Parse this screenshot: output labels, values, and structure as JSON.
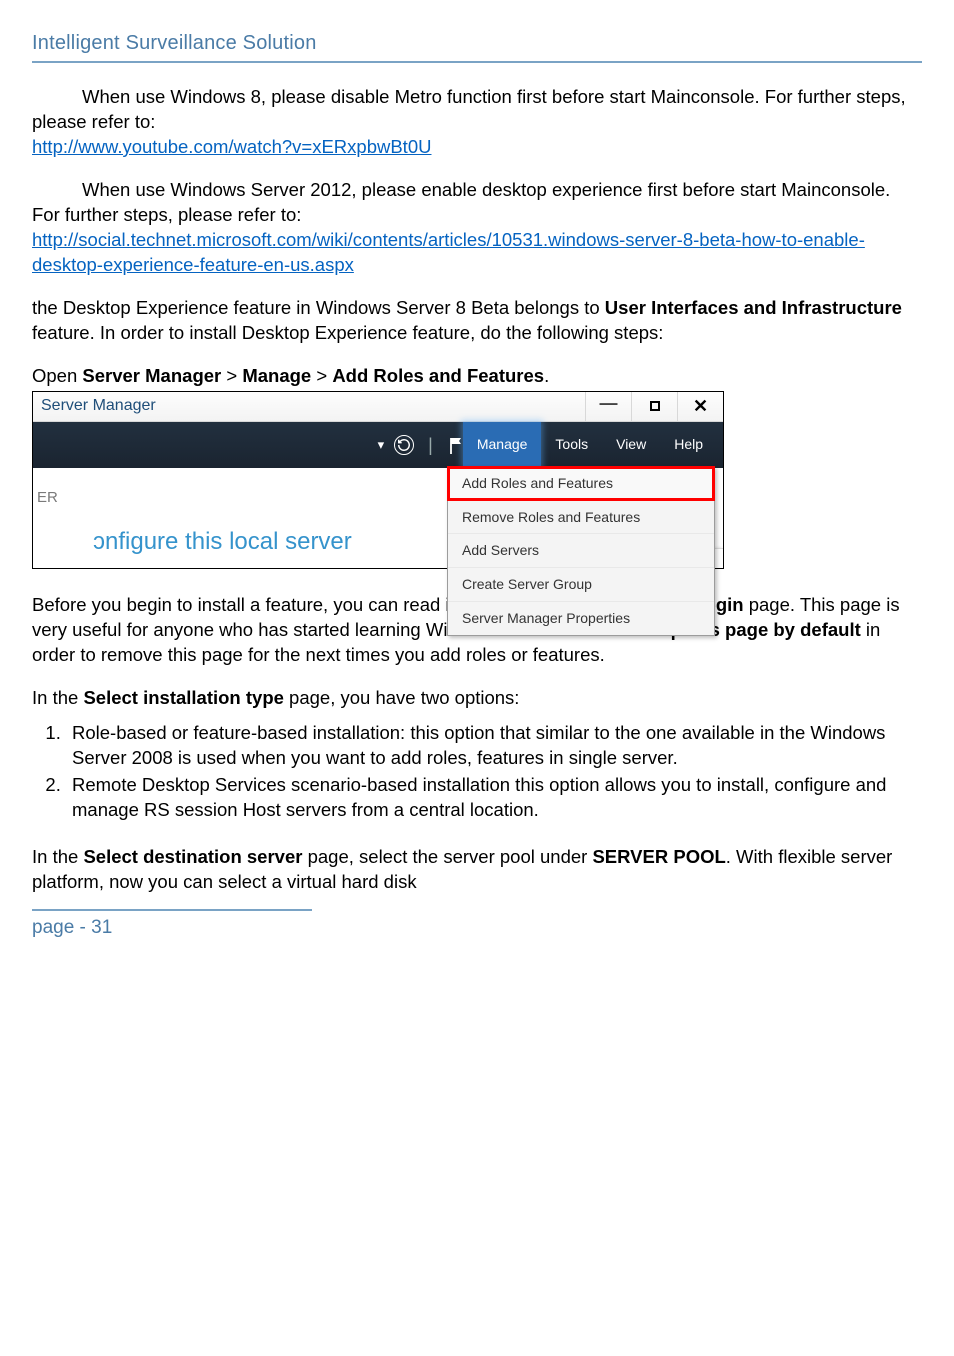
{
  "header": {
    "title": "Intelligent Surveillance Solution"
  },
  "p1": {
    "text1": "When use Windows 8, please disable Metro function first before start Mainconsole. For further steps, please refer to:",
    "link": "http://www.youtube.com/watch?v=xERxpbwBt0U"
  },
  "p2": {
    "text1": "When use Windows Server 2012, please enable desktop experience first before start Mainconsole. For further steps, please refer to:",
    "link": "http://social.technet.microsoft.com/wiki/contents/articles/10531.windows-server-8-beta-how-to-enable-desktop-experience-feature-en-us.aspx"
  },
  "p3": {
    "a": "the Desktop Experience feature in Windows Server 8 Beta belongs to ",
    "b": "User Interfaces and Infrastructure",
    "c": " feature. In order to install Desktop Experience feature, do the following steps:"
  },
  "breadcrumb": {
    "a": "Open ",
    "b": "Server Manager",
    "c": " > ",
    "d": "Manage",
    "e": " > ",
    "f": "Add Roles and Features",
    "g": "."
  },
  "ss": {
    "title": "Server Manager",
    "menus": {
      "manage": "Manage",
      "tools": "Tools",
      "view": "View",
      "help": "Help"
    },
    "dropdown": {
      "i0": "Add Roles and Features",
      "i1": "Remove Roles and Features",
      "i2": "Add Servers",
      "i3": "Create Server Group",
      "i4": "Server Manager Properties"
    },
    "er": "ER",
    "config": "ɔnfigure this local server"
  },
  "p4": {
    "a": "Before you begin to install a feature, you can read information in the ",
    "b": "Before you begin",
    "c": " page. This page is very useful for anyone who has started learning Windows Server 8. Select ",
    "d": "Skip this page by default",
    "e": " in order to remove this page for the next times you add roles or features."
  },
  "p5": {
    "a": "In the ",
    "b": "Select installation type",
    "c": " page, you have two options:"
  },
  "list": {
    "i1": "Role-based or feature-based installation: this option that similar to the one available in the Windows Server 2008 is used when you want to add roles, features in single server.",
    "i2": "Remote Desktop Services scenario-based installation this option allows you to install, configure and manage RS session Host servers from a central location."
  },
  "p6": {
    "a": "In the ",
    "b": "Select destination server",
    "c": " page, select the server pool under ",
    "d": "SERVER POOL",
    "e": ". With flexible server platform, now you can select a virtual hard disk"
  },
  "footer": {
    "page": "page - 31"
  }
}
